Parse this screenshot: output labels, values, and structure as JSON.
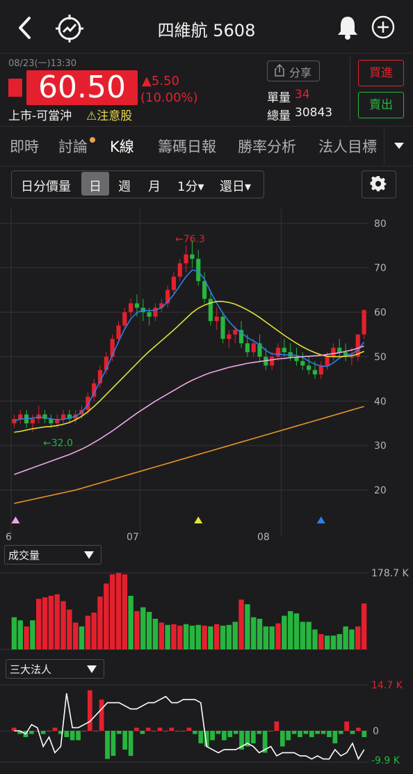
{
  "header": {
    "title": "四維航 5608",
    "back_icon": "back-arrow-icon",
    "compare_icon": "trend-target-icon",
    "alert_icon": "bell-icon",
    "add_icon": "plus-circle-icon"
  },
  "quote": {
    "datetime": "08/23(一)13:30",
    "price": "60.50",
    "change": "▲5.50",
    "change_pct": "(10.00%)",
    "market_label": "上市-可當沖",
    "warning": "⚠注意股",
    "share_label": "分享",
    "unit_vol_label": "單量",
    "unit_vol_value": "34",
    "total_vol_label": "總量",
    "total_vol_value": "30843",
    "buy_label": "買進",
    "sell_label": "賣出"
  },
  "tabs": [
    {
      "label": "即時"
    },
    {
      "label": "討論"
    },
    {
      "label": "K線"
    },
    {
      "label": "籌碼日報"
    },
    {
      "label": "勝率分析"
    },
    {
      "label": "法人目標"
    }
  ],
  "toolbar": {
    "items": [
      "日分價量",
      "日",
      "週",
      "月",
      "1分▾",
      "還日▾"
    ],
    "active": "日"
  },
  "colors": {
    "up": "#e5202e",
    "down": "#27b53f",
    "ma5": "#2f7fe8",
    "ma20": "#e6e23a",
    "ma60": "#f0a6e6",
    "ma120": "#e8952a",
    "bg": "#1c1c1e"
  },
  "panels": {
    "volume_label": "成交量",
    "institutional_label": "三大法人"
  },
  "chart_data": [
    {
      "type": "candlestick",
      "title": "",
      "ylim": [
        15,
        82
      ],
      "yticks": [
        "80",
        "70",
        "60",
        "50",
        "40",
        "30",
        "20"
      ],
      "xticks": [
        "6",
        "07",
        "08"
      ],
      "annotations": [
        "←76.3",
        "←32.0"
      ],
      "markers": [
        "pink-triangle",
        "yellow-triangle",
        "blue-triangle"
      ],
      "ohlc": [
        [
          35,
          37,
          34,
          36
        ],
        [
          36,
          38,
          35,
          37
        ],
        [
          37,
          38,
          34,
          35
        ],
        [
          35,
          37,
          33,
          36
        ],
        [
          36,
          39,
          35,
          37
        ],
        [
          37,
          38,
          35,
          36
        ],
        [
          36,
          37,
          34,
          35
        ],
        [
          35,
          37,
          34,
          36
        ],
        [
          36,
          38,
          35,
          37
        ],
        [
          37,
          38,
          35,
          36
        ],
        [
          36,
          38,
          35,
          37
        ],
        [
          37,
          39,
          36,
          38
        ],
        [
          38,
          42,
          37,
          41
        ],
        [
          41,
          45,
          40,
          44
        ],
        [
          44,
          48,
          43,
          47
        ],
        [
          47,
          51,
          46,
          50
        ],
        [
          50,
          55,
          49,
          54
        ],
        [
          54,
          58,
          53,
          57
        ],
        [
          57,
          61,
          56,
          60
        ],
        [
          60,
          63,
          59,
          62
        ],
        [
          62,
          64,
          59,
          61
        ],
        [
          61,
          63,
          58,
          60
        ],
        [
          60,
          61,
          57,
          59
        ],
        [
          59,
          62,
          58,
          61
        ],
        [
          61,
          63,
          60,
          62
        ],
        [
          62,
          66,
          61,
          65
        ],
        [
          65,
          69,
          64,
          68
        ],
        [
          68,
          72,
          67,
          71
        ],
        [
          71,
          75,
          69,
          73
        ],
        [
          73,
          76.3,
          70,
          72
        ],
        [
          72,
          74,
          66,
          67
        ],
        [
          67,
          69,
          62,
          63
        ],
        [
          63,
          65,
          57,
          58
        ],
        [
          58,
          61,
          56,
          59
        ],
        [
          59,
          60,
          53,
          54
        ],
        [
          54,
          56,
          52,
          55
        ],
        [
          55,
          57,
          53,
          56
        ],
        [
          56,
          58,
          52,
          53
        ],
        [
          53,
          55,
          50,
          51
        ],
        [
          51,
          54,
          50,
          53
        ],
        [
          53,
          55,
          49,
          50
        ],
        [
          50,
          52,
          47,
          48
        ],
        [
          48,
          51,
          47,
          50
        ],
        [
          50,
          53,
          49,
          52
        ],
        [
          52,
          54,
          50,
          51
        ],
        [
          51,
          53,
          49,
          50
        ],
        [
          50,
          52,
          48,
          49
        ],
        [
          49,
          51,
          47,
          48
        ],
        [
          48,
          50,
          46,
          47
        ],
        [
          47,
          49,
          45,
          46
        ],
        [
          46,
          49,
          45,
          48
        ],
        [
          48,
          51,
          47,
          50
        ],
        [
          50,
          53,
          49,
          52
        ],
        [
          52,
          54,
          50,
          51
        ],
        [
          51,
          53,
          49,
          50
        ],
        [
          50,
          52,
          48,
          50
        ],
        [
          50,
          55,
          49,
          55
        ],
        [
          55,
          60.5,
          54,
          60.5
        ]
      ],
      "ma_series": [
        {
          "name": "MA5",
          "values": [
            35.5,
            36,
            36,
            36.2,
            36.4,
            36.3,
            36,
            35.8,
            35.9,
            36.2,
            36.6,
            37.5,
            39.2,
            41.8,
            44.5,
            47.2,
            50.3,
            53.4,
            56.2,
            58.5,
            59.9,
            60.5,
            60.3,
            60.5,
            61,
            62.3,
            64,
            66,
            68,
            69.5,
            69.2,
            67.4,
            64.6,
            62,
            59.8,
            57.9,
            56.4,
            55.4,
            54.3,
            53.5,
            52.7,
            51.4,
            50.6,
            50.6,
            50.4,
            50.4,
            50.3,
            49.8,
            49,
            48.3,
            47.9,
            47.8,
            48.6,
            49.7,
            50.3,
            50.6,
            51.5,
            53.3
          ]
        },
        {
          "name": "MA20",
          "values": [
            33,
            33.2,
            33.5,
            33.8,
            34,
            34.2,
            34.3,
            34.5,
            34.8,
            35.2,
            35.8,
            36.6,
            37.6,
            38.8,
            40.1,
            41.5,
            42.9,
            44.3,
            45.7,
            47.1,
            48.5,
            49.9,
            51.2,
            52.4,
            53.6,
            54.8,
            56,
            57.3,
            58.6,
            59.9,
            60.9,
            61.6,
            62.1,
            62.4,
            62.4,
            62.2,
            61.8,
            61.2,
            60.5,
            59.7,
            58.8,
            57.8,
            56.8,
            55.8,
            54.8,
            53.9,
            53,
            52.2,
            51.5,
            50.9,
            50.4,
            50.1,
            50,
            50,
            50.1,
            50.2,
            50.6,
            51.2
          ]
        },
        {
          "name": "MA60",
          "values": [
            23.5,
            24,
            24.5,
            25,
            25.5,
            26,
            26.5,
            27,
            27.5,
            28,
            28.6,
            29.2,
            29.9,
            30.7,
            31.5,
            32.4,
            33.3,
            34.3,
            35.3,
            36.3,
            37.3,
            38.2,
            39.1,
            40,
            40.8,
            41.6,
            42.4,
            43.2,
            44,
            44.7,
            45.3,
            45.9,
            46.4,
            46.8,
            47.2,
            47.6,
            47.9,
            48.2,
            48.5,
            48.7,
            48.9,
            49.1,
            49.3,
            49.5,
            49.6,
            49.8,
            49.9,
            50,
            50.1,
            50.2,
            50.3,
            50.5,
            50.7,
            50.9,
            51.2,
            51.5,
            51.9,
            52.4
          ]
        },
        {
          "name": "MA120",
          "values": [
            17,
            17.3,
            17.6,
            17.9,
            18.2,
            18.5,
            18.8,
            19.1,
            19.4,
            19.7,
            20,
            20.4,
            20.8,
            21.2,
            21.6,
            22,
            22.4,
            22.8,
            23.2,
            23.6,
            24,
            24.4,
            24.8,
            25.2,
            25.6,
            26,
            26.4,
            26.8,
            27.2,
            27.6,
            28,
            28.4,
            28.8,
            29.2,
            29.6,
            30,
            30.4,
            30.8,
            31.2,
            31.6,
            32,
            32.4,
            32.8,
            33.2,
            33.6,
            34,
            34.4,
            34.8,
            35.2,
            35.6,
            36,
            36.4,
            36.8,
            37.2,
            37.6,
            38,
            38.4,
            38.8
          ]
        }
      ]
    },
    {
      "type": "bar",
      "title": "成交量",
      "max_label": "178.7 K",
      "values": [
        42,
        38,
        30,
        38,
        66,
        68,
        70,
        72,
        63,
        52,
        35,
        30,
        44,
        48,
        69,
        86,
        98,
        100,
        98,
        70,
        50,
        55,
        49,
        40,
        35,
        32,
        33,
        31,
        33,
        31,
        32,
        31,
        30,
        33,
        31,
        32,
        36,
        65,
        59,
        42,
        40,
        30,
        30,
        34,
        44,
        50,
        47,
        36,
        36,
        26,
        20,
        18,
        18,
        20,
        30,
        26,
        30,
        60
      ],
      "up_flags": [
        0,
        0,
        1,
        0,
        1,
        1,
        1,
        1,
        1,
        1,
        1,
        0,
        1,
        1,
        1,
        1,
        1,
        1,
        1,
        0,
        1,
        0,
        0,
        0,
        1,
        0,
        1,
        1,
        0,
        0,
        0,
        1,
        0,
        1,
        0,
        0,
        0,
        1,
        0,
        0,
        0,
        0,
        0,
        1,
        0,
        0,
        0,
        0,
        0,
        0,
        1,
        0,
        0,
        0,
        0,
        0,
        1,
        1
      ]
    },
    {
      "type": "bar",
      "title": "三大法人",
      "max_label": "14.7 K",
      "zero_label": "0",
      "min_label": "-9.9 K",
      "values": [
        1,
        -1,
        -2,
        -1,
        0,
        -1,
        0,
        1,
        -1,
        -2,
        -3,
        -3,
        0,
        13,
        0,
        10,
        -9,
        -8,
        -1,
        -6,
        -8,
        1,
        -1,
        1,
        0,
        1,
        0,
        1,
        0,
        0,
        1,
        -1,
        -4,
        -5,
        -3,
        -1,
        -3,
        -2,
        -1,
        -6,
        -5,
        -4,
        -1,
        -7,
        0,
        3,
        -5,
        -3,
        -1,
        -2,
        -1,
        -2,
        -1,
        -1,
        -2,
        -4,
        -1,
        3,
        -1,
        1,
        -2
      ],
      "line": [
        0,
        0,
        -1,
        2,
        1,
        -5,
        -2,
        -7,
        -5,
        12,
        1,
        1,
        2,
        3,
        5,
        7,
        9,
        9,
        9,
        8,
        7,
        7,
        8,
        9,
        9,
        10,
        11,
        9,
        9,
        10,
        10,
        10,
        9,
        -5,
        -6,
        -7,
        -6,
        -6,
        -6,
        -5,
        -4,
        -5,
        -7,
        -6,
        -5,
        -8,
        -7,
        -7,
        -7,
        -8,
        -8,
        -9,
        -8,
        -9,
        -9,
        -6,
        -8,
        -7,
        -4,
        -9,
        -6
      ]
    }
  ]
}
